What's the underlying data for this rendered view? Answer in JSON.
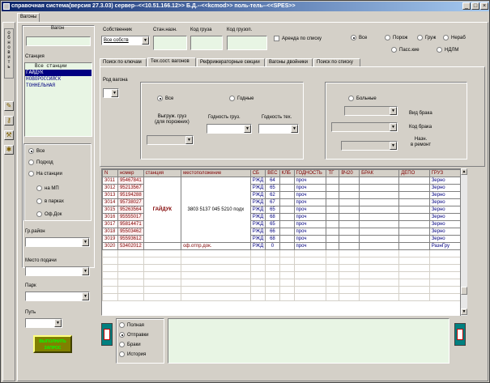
{
  "window": {
    "title": "справочная система(версия 27.3.03) сервер--<<10.51.166.12>> Б.Д.--<<kcmod>> поль-тель--<<SPES>>",
    "minimize": "_",
    "maximize": "□",
    "close": "×"
  },
  "main_tab": "Вагоны",
  "left_strip": {
    "refresh_text": [
      "о",
      "б",
      "н",
      "о",
      "в",
      "и",
      "т",
      "ь"
    ]
  },
  "left_panel": {
    "wagon_label": "Вагон",
    "wagon_value": "",
    "station_label": "Станция",
    "stations": [
      "Все станции",
      "ГАЙДУК",
      "НОВОРОССИЙСК",
      "ТОННЕЛЬНАЯ"
    ],
    "selected_station_index": 1,
    "location_radios": [
      "Все",
      "Подход",
      "На станции",
      "на МП",
      "в парках",
      "Оф.Док"
    ],
    "location_selected": 0,
    "gr_district_label": "Гр.район",
    "supply_place_label": "Место подачи",
    "park_label": "Парк",
    "track_label": "Путь",
    "execute_button": "ВЫПОЛНИТЬ ЗАПРОС"
  },
  "header_filters": {
    "owner_label": "Собственник",
    "owner_value": "Все собств",
    "dest_station_label": "Стан.назн.",
    "cargo_code_label": "Код груза",
    "cargo_shipper_label": "Код грузоп.",
    "lease_label": "Аренда по списку",
    "type_radios": [
      "Все",
      "Порож",
      "Груж",
      "Нераб",
      "Пасс.кие",
      "НДЛМ"
    ],
    "type_selected": 0
  },
  "subtabs": [
    "Поиск по ключам",
    "Тех.сост. вагонов",
    "Рефрижераторные секции",
    "Вагоны двойники",
    "Поиск по списку"
  ],
  "subtab_active": 1,
  "tech_state": {
    "wagon_kind_label": "Род вагона",
    "suitability_all": "Все",
    "suitable": "Годные",
    "sick": "Больные",
    "unload_cargo_label": "Выгруж. груз\n(для порожних)",
    "suitability_cargo_label": "Годность груз.",
    "suitability_tech_label": "Годность тех.",
    "defect_kind_label": "Вид брака",
    "defect_code_label": "Код брака",
    "repair_assign_label": "Назн.\nв ремонт"
  },
  "table": {
    "columns": [
      "N",
      "номер",
      "станция",
      "местоположение",
      "СБ",
      "ВЕС",
      "КЛБ",
      "ГОДНОСТЬ",
      "ТГ",
      "ВЧ20",
      "БРАК",
      "ДЕПО",
      "ГРУЗ"
    ],
    "station_merged": "ГАЙДУК",
    "location_merged": "3803 5137 045 5210 подх",
    "rows": [
      {
        "n": "3011",
        "num": "95467841",
        "sb": "РЖД",
        "ves": "64",
        "god": "проч",
        "gruz": "Зерно"
      },
      {
        "n": "3012",
        "num": "95213567",
        "sb": "РЖД",
        "ves": "65",
        "god": "проч",
        "gruz": "Зерно"
      },
      {
        "n": "3013",
        "num": "95194288",
        "sb": "РЖД",
        "ves": "62",
        "god": "проч",
        "gruz": "Зерно"
      },
      {
        "n": "3014",
        "num": "95738027",
        "sb": "РЖД",
        "ves": "67",
        "god": "проч",
        "gruz": "Зерно"
      },
      {
        "n": "3015",
        "num": "95263564",
        "sb": "РЖД",
        "ves": "65",
        "god": "проч",
        "gruz": "Зерно"
      },
      {
        "n": "3016",
        "num": "95555017",
        "sb": "РЖД",
        "ves": "68",
        "god": "проч",
        "gruz": "Зерно"
      },
      {
        "n": "3017",
        "num": "95814471",
        "sb": "РЖД",
        "ves": "65",
        "god": "проч",
        "gruz": "Зерно"
      },
      {
        "n": "3018",
        "num": "95503462",
        "sb": "РЖД",
        "ves": "66",
        "god": "проч",
        "gruz": "Зерно"
      },
      {
        "n": "3019",
        "num": "95593612",
        "sb": "РЖД",
        "ves": "68",
        "god": "проч",
        "gruz": "Зерно"
      },
      {
        "n": "3020",
        "num": "53402012",
        "sb": "РЖД",
        "ves": "0",
        "god": "проч",
        "gruz": "РазнГру",
        "loc": "оф.отпр.док."
      }
    ]
  },
  "bottom": {
    "radios": [
      "Полная",
      "Отправки",
      "Браки",
      "История"
    ],
    "selected": 1
  }
}
